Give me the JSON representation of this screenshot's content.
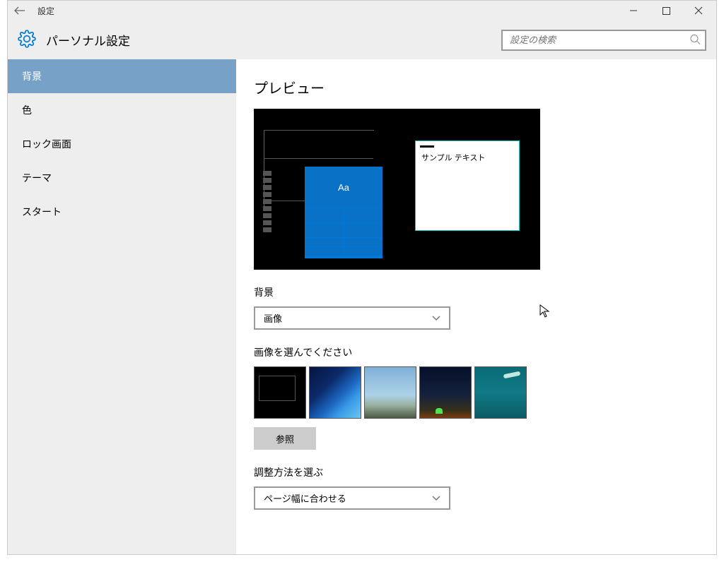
{
  "titlebar": {
    "title": "設定"
  },
  "header": {
    "title": "パーソナル設定",
    "search_placeholder": "設定の検索"
  },
  "sidebar": {
    "items": [
      {
        "label": "背景",
        "active": true
      },
      {
        "label": "色",
        "active": false
      },
      {
        "label": "ロック画面",
        "active": false
      },
      {
        "label": "テーマ",
        "active": false
      },
      {
        "label": "スタート",
        "active": false
      }
    ]
  },
  "content": {
    "preview_title": "プレビュー",
    "sample_text": "サンプル テキスト",
    "tile_text": "Aa",
    "bg_label": "背景",
    "bg_selected": "画像",
    "choose_label": "画像を選んでください",
    "browse_label": "参照",
    "fit_label": "調整方法を選ぶ",
    "fit_selected": "ページ幅に合わせる"
  }
}
